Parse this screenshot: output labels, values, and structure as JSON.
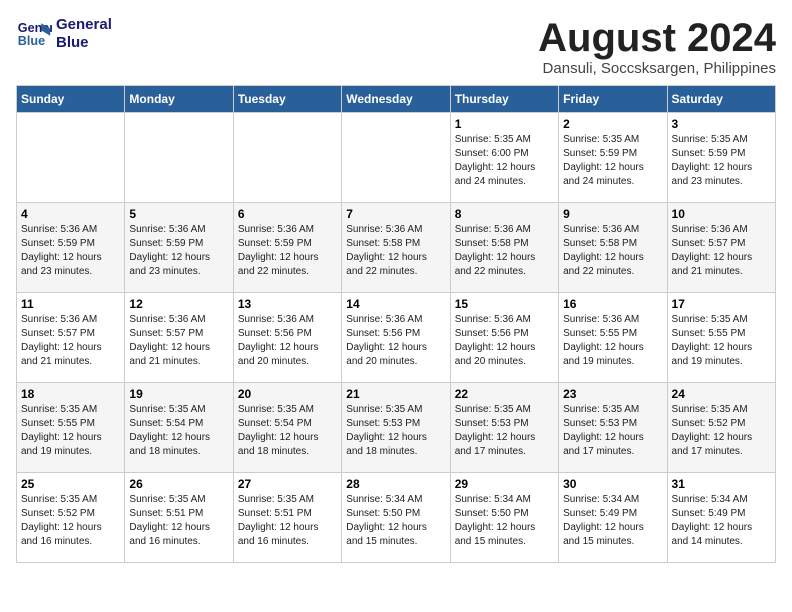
{
  "header": {
    "logo_line1": "General",
    "logo_line2": "Blue",
    "month": "August 2024",
    "location": "Dansuli, Soccsksargen, Philippines"
  },
  "weekdays": [
    "Sunday",
    "Monday",
    "Tuesday",
    "Wednesday",
    "Thursday",
    "Friday",
    "Saturday"
  ],
  "weeks": [
    [
      {
        "day": "",
        "sunrise": "",
        "sunset": "",
        "daylight": ""
      },
      {
        "day": "",
        "sunrise": "",
        "sunset": "",
        "daylight": ""
      },
      {
        "day": "",
        "sunrise": "",
        "sunset": "",
        "daylight": ""
      },
      {
        "day": "",
        "sunrise": "",
        "sunset": "",
        "daylight": ""
      },
      {
        "day": "1",
        "sunrise": "Sunrise: 5:35 AM",
        "sunset": "Sunset: 6:00 PM",
        "daylight": "Daylight: 12 hours and 24 minutes."
      },
      {
        "day": "2",
        "sunrise": "Sunrise: 5:35 AM",
        "sunset": "Sunset: 5:59 PM",
        "daylight": "Daylight: 12 hours and 24 minutes."
      },
      {
        "day": "3",
        "sunrise": "Sunrise: 5:35 AM",
        "sunset": "Sunset: 5:59 PM",
        "daylight": "Daylight: 12 hours and 23 minutes."
      }
    ],
    [
      {
        "day": "4",
        "sunrise": "Sunrise: 5:36 AM",
        "sunset": "Sunset: 5:59 PM",
        "daylight": "Daylight: 12 hours and 23 minutes."
      },
      {
        "day": "5",
        "sunrise": "Sunrise: 5:36 AM",
        "sunset": "Sunset: 5:59 PM",
        "daylight": "Daylight: 12 hours and 23 minutes."
      },
      {
        "day": "6",
        "sunrise": "Sunrise: 5:36 AM",
        "sunset": "Sunset: 5:59 PM",
        "daylight": "Daylight: 12 hours and 22 minutes."
      },
      {
        "day": "7",
        "sunrise": "Sunrise: 5:36 AM",
        "sunset": "Sunset: 5:58 PM",
        "daylight": "Daylight: 12 hours and 22 minutes."
      },
      {
        "day": "8",
        "sunrise": "Sunrise: 5:36 AM",
        "sunset": "Sunset: 5:58 PM",
        "daylight": "Daylight: 12 hours and 22 minutes."
      },
      {
        "day": "9",
        "sunrise": "Sunrise: 5:36 AM",
        "sunset": "Sunset: 5:58 PM",
        "daylight": "Daylight: 12 hours and 22 minutes."
      },
      {
        "day": "10",
        "sunrise": "Sunrise: 5:36 AM",
        "sunset": "Sunset: 5:57 PM",
        "daylight": "Daylight: 12 hours and 21 minutes."
      }
    ],
    [
      {
        "day": "11",
        "sunrise": "Sunrise: 5:36 AM",
        "sunset": "Sunset: 5:57 PM",
        "daylight": "Daylight: 12 hours and 21 minutes."
      },
      {
        "day": "12",
        "sunrise": "Sunrise: 5:36 AM",
        "sunset": "Sunset: 5:57 PM",
        "daylight": "Daylight: 12 hours and 21 minutes."
      },
      {
        "day": "13",
        "sunrise": "Sunrise: 5:36 AM",
        "sunset": "Sunset: 5:56 PM",
        "daylight": "Daylight: 12 hours and 20 minutes."
      },
      {
        "day": "14",
        "sunrise": "Sunrise: 5:36 AM",
        "sunset": "Sunset: 5:56 PM",
        "daylight": "Daylight: 12 hours and 20 minutes."
      },
      {
        "day": "15",
        "sunrise": "Sunrise: 5:36 AM",
        "sunset": "Sunset: 5:56 PM",
        "daylight": "Daylight: 12 hours and 20 minutes."
      },
      {
        "day": "16",
        "sunrise": "Sunrise: 5:36 AM",
        "sunset": "Sunset: 5:55 PM",
        "daylight": "Daylight: 12 hours and 19 minutes."
      },
      {
        "day": "17",
        "sunrise": "Sunrise: 5:35 AM",
        "sunset": "Sunset: 5:55 PM",
        "daylight": "Daylight: 12 hours and 19 minutes."
      }
    ],
    [
      {
        "day": "18",
        "sunrise": "Sunrise: 5:35 AM",
        "sunset": "Sunset: 5:55 PM",
        "daylight": "Daylight: 12 hours and 19 minutes."
      },
      {
        "day": "19",
        "sunrise": "Sunrise: 5:35 AM",
        "sunset": "Sunset: 5:54 PM",
        "daylight": "Daylight: 12 hours and 18 minutes."
      },
      {
        "day": "20",
        "sunrise": "Sunrise: 5:35 AM",
        "sunset": "Sunset: 5:54 PM",
        "daylight": "Daylight: 12 hours and 18 minutes."
      },
      {
        "day": "21",
        "sunrise": "Sunrise: 5:35 AM",
        "sunset": "Sunset: 5:53 PM",
        "daylight": "Daylight: 12 hours and 18 minutes."
      },
      {
        "day": "22",
        "sunrise": "Sunrise: 5:35 AM",
        "sunset": "Sunset: 5:53 PM",
        "daylight": "Daylight: 12 hours and 17 minutes."
      },
      {
        "day": "23",
        "sunrise": "Sunrise: 5:35 AM",
        "sunset": "Sunset: 5:53 PM",
        "daylight": "Daylight: 12 hours and 17 minutes."
      },
      {
        "day": "24",
        "sunrise": "Sunrise: 5:35 AM",
        "sunset": "Sunset: 5:52 PM",
        "daylight": "Daylight: 12 hours and 17 minutes."
      }
    ],
    [
      {
        "day": "25",
        "sunrise": "Sunrise: 5:35 AM",
        "sunset": "Sunset: 5:52 PM",
        "daylight": "Daylight: 12 hours and 16 minutes."
      },
      {
        "day": "26",
        "sunrise": "Sunrise: 5:35 AM",
        "sunset": "Sunset: 5:51 PM",
        "daylight": "Daylight: 12 hours and 16 minutes."
      },
      {
        "day": "27",
        "sunrise": "Sunrise: 5:35 AM",
        "sunset": "Sunset: 5:51 PM",
        "daylight": "Daylight: 12 hours and 16 minutes."
      },
      {
        "day": "28",
        "sunrise": "Sunrise: 5:34 AM",
        "sunset": "Sunset: 5:50 PM",
        "daylight": "Daylight: 12 hours and 15 minutes."
      },
      {
        "day": "29",
        "sunrise": "Sunrise: 5:34 AM",
        "sunset": "Sunset: 5:50 PM",
        "daylight": "Daylight: 12 hours and 15 minutes."
      },
      {
        "day": "30",
        "sunrise": "Sunrise: 5:34 AM",
        "sunset": "Sunset: 5:49 PM",
        "daylight": "Daylight: 12 hours and 15 minutes."
      },
      {
        "day": "31",
        "sunrise": "Sunrise: 5:34 AM",
        "sunset": "Sunset: 5:49 PM",
        "daylight": "Daylight: 12 hours and 14 minutes."
      }
    ]
  ]
}
